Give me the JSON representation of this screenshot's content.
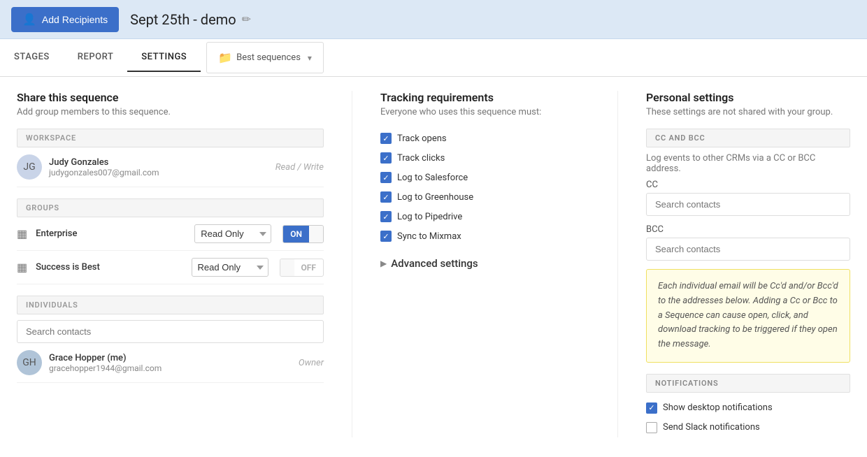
{
  "header": {
    "add_recipients_label": "Add Recipients",
    "sequence_title": "Sept 25th - demo",
    "edit_icon": "✏"
  },
  "tabs": {
    "stages": "STAGES",
    "report": "REPORT",
    "settings": "SETTINGS",
    "best_sequences": "Best sequences"
  },
  "share": {
    "title": "Share this sequence",
    "subtitle": "Add group members to this sequence.",
    "workspace_label": "WORKSPACE",
    "groups_label": "GROUPS",
    "individuals_label": "INDIVIDUALS",
    "workspace_user": {
      "name": "Judy Gonzales",
      "email": "judygonzales007@gmail.com",
      "role": "Read / Write"
    },
    "groups": [
      {
        "name": "Enterprise",
        "permission": "Read Only",
        "toggle_on": "ON",
        "toggle_off": "",
        "active": true
      },
      {
        "name": "Success is Best",
        "permission": "Read Only",
        "toggle_on": "",
        "toggle_off": "OFF",
        "active": false
      }
    ],
    "search_placeholder": "Search contacts",
    "individual_user": {
      "name": "Grace Hopper (me)",
      "email": "gracehopper1944@gmail.com",
      "role": "Owner"
    }
  },
  "tracking": {
    "title": "Tracking requirements",
    "subtitle": "Everyone who uses this sequence must:",
    "items": [
      "Track opens",
      "Track clicks",
      "Log to Salesforce",
      "Log to Greenhouse",
      "Log to Pipedrive",
      "Sync to Mixmax"
    ],
    "advanced_settings": "Advanced settings"
  },
  "personal": {
    "title": "Personal settings",
    "subtitle": "These settings are not shared with your group.",
    "cc_bcc_label": "CC AND BCC",
    "cc_bcc_desc": "Log events to other CRMs via a CC or BCC address.",
    "cc_label": "CC",
    "bcc_label": "BCC",
    "search_placeholder_cc": "Search contacts",
    "search_placeholder_bcc": "Search contacts",
    "warning_text": "Each individual email will be Cc'd and/or Bcc'd to the addresses below. Adding a Cc or Bcc to a Sequence can cause open, click, and download tracking to be triggered if they open the message.",
    "notifications_label": "NOTIFICATIONS",
    "notifications": [
      {
        "label": "Show desktop notifications",
        "checked": true
      },
      {
        "label": "Send Slack notifications",
        "checked": false
      }
    ]
  }
}
